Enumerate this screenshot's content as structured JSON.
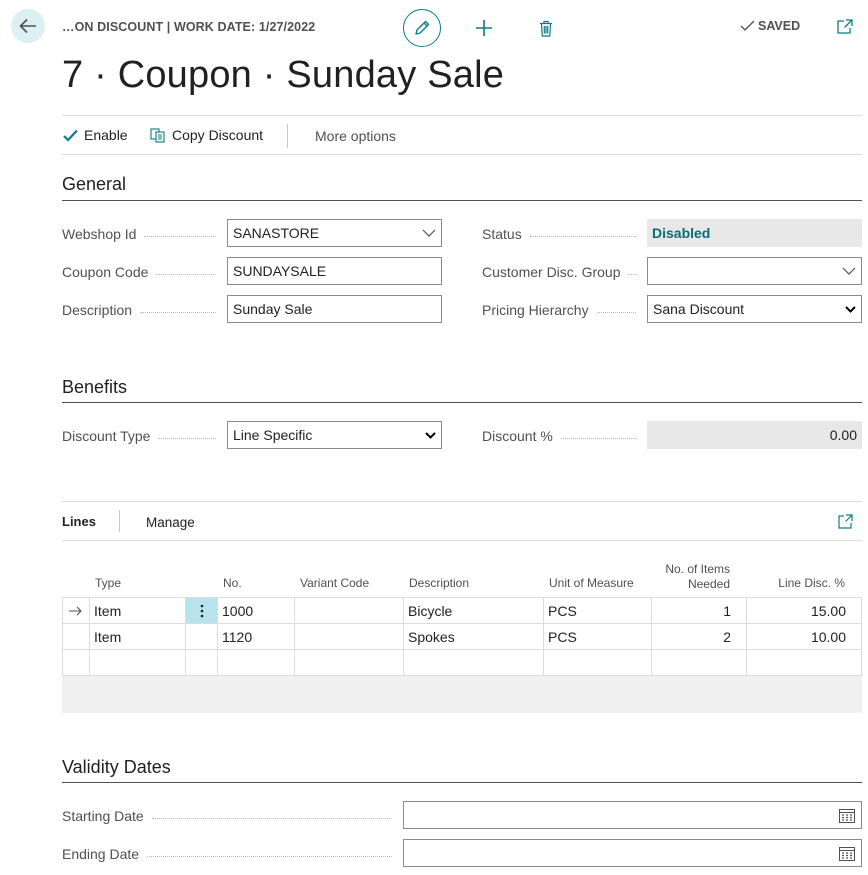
{
  "header": {
    "breadcrumb": "…ON DISCOUNT | WORK DATE: 1/27/2022",
    "saved_label": "SAVED",
    "title": "7 · Coupon · Sunday Sale"
  },
  "actions": {
    "enable": "Enable",
    "copy_discount": "Copy Discount",
    "more_options": "More options"
  },
  "general": {
    "title": "General",
    "webshop_id": {
      "label": "Webshop Id",
      "value": "SANASTORE"
    },
    "coupon_code": {
      "label": "Coupon Code",
      "value": "SUNDAYSALE"
    },
    "description": {
      "label": "Description",
      "value": "Sunday Sale"
    },
    "status": {
      "label": "Status",
      "value": "Disabled"
    },
    "customer_disc_group": {
      "label": "Customer Disc. Group",
      "value": ""
    },
    "pricing_hierarchy": {
      "label": "Pricing Hierarchy",
      "value": "Sana Discount"
    }
  },
  "benefits": {
    "title": "Benefits",
    "discount_type": {
      "label": "Discount Type",
      "value": "Line Specific"
    },
    "discount_pct": {
      "label": "Discount %",
      "value": "0.00"
    }
  },
  "lines": {
    "tab_lines": "Lines",
    "tab_manage": "Manage",
    "columns": {
      "type": "Type",
      "no": "No.",
      "variant_code": "Variant Code",
      "description": "Description",
      "uom": "Unit of Measure",
      "items_needed_1": "No. of Items",
      "items_needed_2": "Needed",
      "line_disc": "Line Disc. %"
    },
    "rows": [
      {
        "type": "Item",
        "no": "1000",
        "variant_code": "",
        "description": "Bicycle",
        "uom": "PCS",
        "items_needed": "1",
        "line_disc": "15.00"
      },
      {
        "type": "Item",
        "no": "1120",
        "variant_code": "",
        "description": "Spokes",
        "uom": "PCS",
        "items_needed": "2",
        "line_disc": "10.00"
      }
    ]
  },
  "validity": {
    "title": "Validity Dates",
    "starting_date": {
      "label": "Starting Date",
      "value": ""
    },
    "ending_date": {
      "label": "Ending Date",
      "value": ""
    }
  },
  "colors": {
    "accent": "#0a7c86",
    "status_text": "#0a6c74",
    "back_bg": "#dceff3"
  },
  "icons": [
    "back-arrow-icon",
    "pencil-icon",
    "plus-icon",
    "trash-icon",
    "check-icon",
    "popout-icon",
    "copy-icon",
    "chevron-down-icon",
    "row-arrow-icon",
    "kebab-icon",
    "calendar-icon",
    "expand-icon"
  ]
}
